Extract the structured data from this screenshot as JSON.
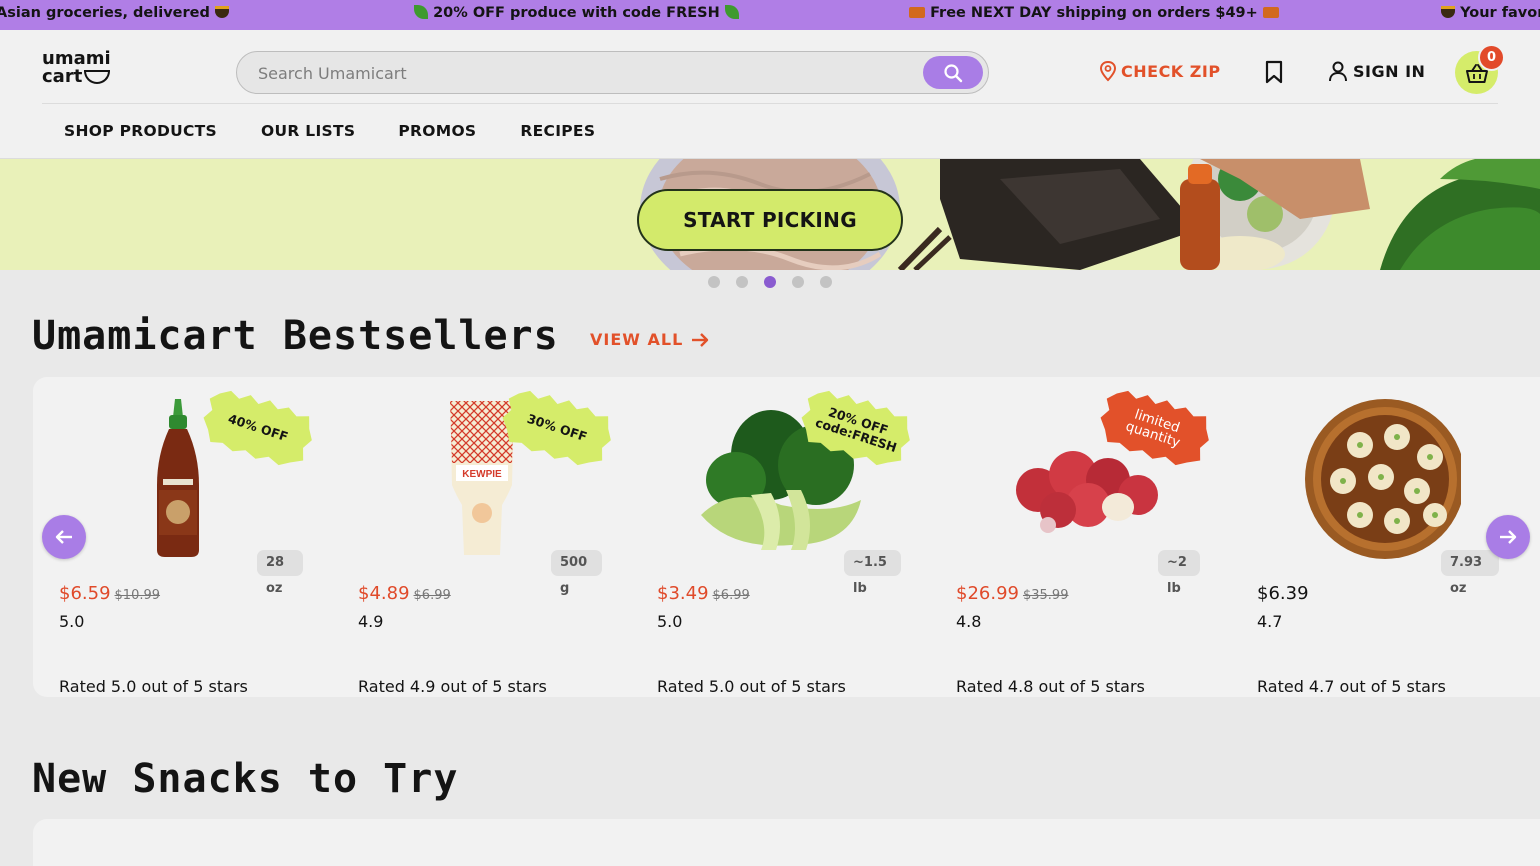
{
  "announcement": {
    "items": [
      {
        "text": "Asian groceries, delivered",
        "icon": "pot-icon"
      },
      {
        "text": "20% OFF produce with code FRESH",
        "icon": "leaf-icon"
      },
      {
        "text": "Free NEXT DAY shipping on orders $49+",
        "icon": "truck-icon"
      },
      {
        "text": "Your favor",
        "icon": "pot-icon"
      }
    ]
  },
  "header": {
    "logo_line1": "umami",
    "logo_line2": "cart",
    "search_placeholder": "Search Umamicart",
    "check_zip": "CHECK ZIP",
    "sign_in": "SIGN IN",
    "cart_count": "0"
  },
  "nav": {
    "items": [
      "SHOP PRODUCTS",
      "OUR LISTS",
      "PROMOS",
      "RECIPES"
    ]
  },
  "hero": {
    "button": "START PICKING",
    "slides": 5,
    "active_slide": 3
  },
  "bestsellers": {
    "title": "Umamicart Bestsellers",
    "view_all": "VIEW ALL",
    "products": [
      {
        "tag": "40% OFF",
        "weight": "28 oz",
        "price": "$6.59",
        "was": "$10.99",
        "rating": "5.0",
        "rated": "Rated 5.0 out of 5 stars",
        "image": "sriracha-bottle"
      },
      {
        "tag": "30% OFF",
        "weight": "500 g",
        "price": "$4.89",
        "was": "$6.99",
        "rating": "4.9",
        "rated": "Rated 4.9 out of 5 stars",
        "image": "kewpie-mayo"
      },
      {
        "tag": "20% OFF code:FRESH",
        "weight": "~1.5 lb",
        "price": "$3.49",
        "was": "$6.99",
        "rating": "5.0",
        "rated": "Rated 5.0 out of 5 stars",
        "image": "bok-choy"
      },
      {
        "tag": "limited quantity",
        "weight": "~2 lb",
        "price": "$26.99",
        "was": "$35.99",
        "rating": "4.8",
        "rated": "Rated 4.8 out of 5 stars",
        "image": "lychee"
      },
      {
        "tag": "",
        "weight": "7.93 oz",
        "price": "$6.39",
        "was": "",
        "rating": "4.7",
        "rated": "Rated 4.7 out of 5 stars",
        "image": "dumplings"
      }
    ]
  },
  "new_snacks": {
    "title": "New Snacks to Try"
  },
  "colors": {
    "announcement_bg": "#b07ee6",
    "accent_orange": "#e2512a",
    "accent_purple": "#a97de6",
    "lime": "#d3ea6b",
    "sale_red": "#e04a2a"
  }
}
